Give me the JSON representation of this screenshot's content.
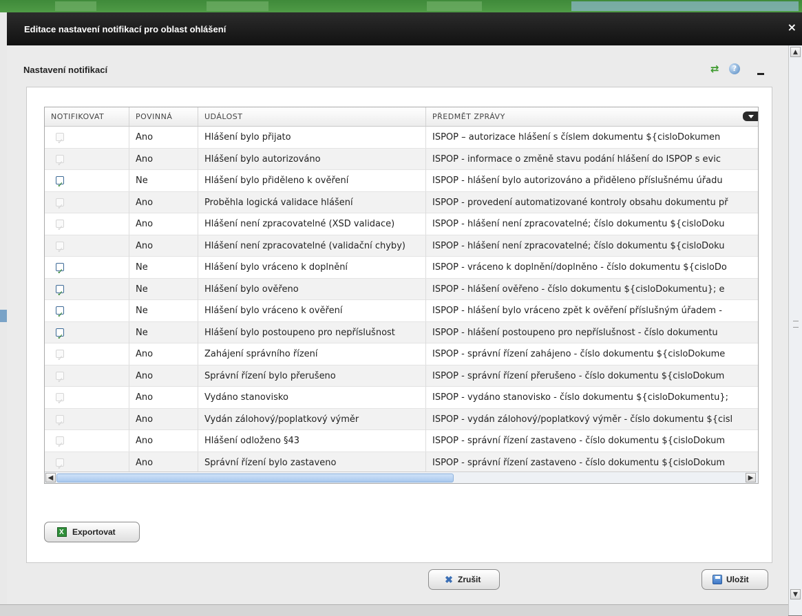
{
  "dialog": {
    "title": "Editace nastavení notifikací pro oblast ohlášení",
    "close_glyph": "×"
  },
  "section": {
    "title": "Nastavení notifikací",
    "tools": {
      "refresh_icon": "refresh-icon",
      "help_icon": "help-icon",
      "minimize_icon": "minimize-icon"
    }
  },
  "grid": {
    "columns": [
      "NOTIFIKOVAT",
      "POVINNÁ",
      "UDÁLOST",
      "PŘEDMĚT ZPRÁVY"
    ],
    "rows": [
      {
        "notify": false,
        "required": "Ano",
        "event": "Hlášení bylo přijato",
        "subject": "ISPOP – autorizace hlášení s číslem dokumentu ${cisloDokumen"
      },
      {
        "notify": false,
        "required": "Ano",
        "event": "Hlášení bylo autorizováno",
        "subject": "ISPOP - informace o změně stavu podání hlášení do ISPOP s evic"
      },
      {
        "notify": true,
        "required": "Ne",
        "event": "Hlášení bylo přiděleno k ověření",
        "subject": "ISPOP - hlášení bylo autorizováno a přiděleno příslušnému úřadu"
      },
      {
        "notify": false,
        "required": "Ano",
        "event": "Proběhla logická validace hlášení",
        "subject": "ISPOP - provedení automatizované kontroly obsahu dokumentu př"
      },
      {
        "notify": false,
        "required": "Ano",
        "event": "Hlášení není zpracovatelné (XSD validace)",
        "subject": "ISPOP - hlášení není zpracovatelné; číslo dokumentu ${cisloDoku"
      },
      {
        "notify": false,
        "required": "Ano",
        "event": "Hlášení není zpracovatelné (validační chyby)",
        "subject": "ISPOP - hlášení není zpracovatelné; číslo dokumentu ${cisloDoku"
      },
      {
        "notify": true,
        "required": "Ne",
        "event": "Hlášení bylo vráceno k doplnění",
        "subject": "ISPOP - vráceno k doplnění/doplněno - číslo dokumentu ${cisloDo"
      },
      {
        "notify": true,
        "required": "Ne",
        "event": "Hlášení bylo ověřeno",
        "subject": "ISPOP - hlášení ověřeno - číslo dokumentu ${cisloDokumentu}; e"
      },
      {
        "notify": true,
        "required": "Ne",
        "event": "Hlášení bylo vráceno k ověření",
        "subject": "ISPOP - hlášení bylo vráceno zpět k ověření příslušným úřadem -"
      },
      {
        "notify": true,
        "required": "Ne",
        "event": "Hlášení bylo postoupeno pro nepříslušnost",
        "subject": "ISPOP - hlášení postoupeno pro nepříslušnost - číslo dokumentu"
      },
      {
        "notify": false,
        "required": "Ano",
        "event": "Zahájení správního řízení",
        "subject": "ISPOP - správní řízení zahájeno - číslo dokumentu ${cisloDokume"
      },
      {
        "notify": false,
        "required": "Ano",
        "event": "Správní řízení bylo přerušeno",
        "subject": "ISPOP - správní řízení přerušeno - číslo dokumentu ${cisloDokum"
      },
      {
        "notify": false,
        "required": "Ano",
        "event": "Vydáno stanovisko",
        "subject": "ISPOP - vydáno stanovisko - číslo dokumentu ${cisloDokumentu};"
      },
      {
        "notify": false,
        "required": "Ano",
        "event": "Vydán zálohový/poplatkový výměr",
        "subject": "ISPOP - vydán zálohový/poplatkový výměr - číslo dokumentu ${cisl"
      },
      {
        "notify": false,
        "required": "Ano",
        "event": "Hlášení odloženo §43",
        "subject": "ISPOP - správní řízení zastaveno - číslo dokumentu ${cisloDokum"
      },
      {
        "notify": false,
        "required": "Ano",
        "event": "Správní řízení bylo zastaveno",
        "subject": "ISPOP - správní řízení zastaveno - číslo dokumentu ${cisloDokum"
      }
    ]
  },
  "buttons": {
    "export": "Exportovat",
    "cancel": "Zrušit",
    "save": "Uložit"
  },
  "colors": {
    "titlebar": "#1a1a1a",
    "checked": "#1f7a1f",
    "scroll_thumb": "#a9c8ee"
  }
}
